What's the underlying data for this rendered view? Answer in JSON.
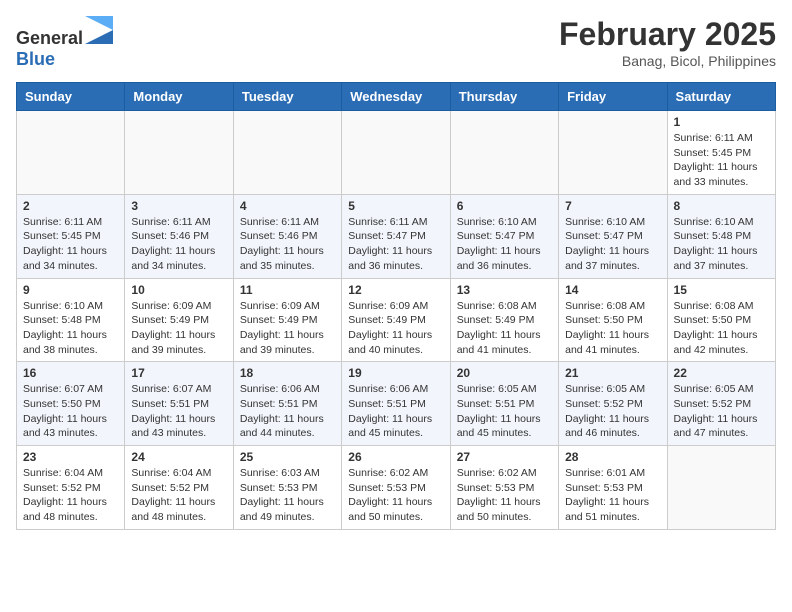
{
  "header": {
    "logo_general": "General",
    "logo_blue": "Blue",
    "month_year": "February 2025",
    "location": "Banag, Bicol, Philippines"
  },
  "weekdays": [
    "Sunday",
    "Monday",
    "Tuesday",
    "Wednesday",
    "Thursday",
    "Friday",
    "Saturday"
  ],
  "weeks": [
    [
      {
        "day": "",
        "sunrise": "",
        "sunset": "",
        "daylight": "",
        "empty": true
      },
      {
        "day": "",
        "sunrise": "",
        "sunset": "",
        "daylight": "",
        "empty": true
      },
      {
        "day": "",
        "sunrise": "",
        "sunset": "",
        "daylight": "",
        "empty": true
      },
      {
        "day": "",
        "sunrise": "",
        "sunset": "",
        "daylight": "",
        "empty": true
      },
      {
        "day": "",
        "sunrise": "",
        "sunset": "",
        "daylight": "",
        "empty": true
      },
      {
        "day": "",
        "sunrise": "",
        "sunset": "",
        "daylight": "",
        "empty": true
      },
      {
        "day": "1",
        "sunrise": "Sunrise: 6:11 AM",
        "sunset": "Sunset: 5:45 PM",
        "daylight": "Daylight: 11 hours and 33 minutes.",
        "empty": false
      }
    ],
    [
      {
        "day": "2",
        "sunrise": "Sunrise: 6:11 AM",
        "sunset": "Sunset: 5:45 PM",
        "daylight": "Daylight: 11 hours and 34 minutes.",
        "empty": false
      },
      {
        "day": "3",
        "sunrise": "Sunrise: 6:11 AM",
        "sunset": "Sunset: 5:46 PM",
        "daylight": "Daylight: 11 hours and 34 minutes.",
        "empty": false
      },
      {
        "day": "4",
        "sunrise": "Sunrise: 6:11 AM",
        "sunset": "Sunset: 5:46 PM",
        "daylight": "Daylight: 11 hours and 35 minutes.",
        "empty": false
      },
      {
        "day": "5",
        "sunrise": "Sunrise: 6:11 AM",
        "sunset": "Sunset: 5:47 PM",
        "daylight": "Daylight: 11 hours and 36 minutes.",
        "empty": false
      },
      {
        "day": "6",
        "sunrise": "Sunrise: 6:10 AM",
        "sunset": "Sunset: 5:47 PM",
        "daylight": "Daylight: 11 hours and 36 minutes.",
        "empty": false
      },
      {
        "day": "7",
        "sunrise": "Sunrise: 6:10 AM",
        "sunset": "Sunset: 5:47 PM",
        "daylight": "Daylight: 11 hours and 37 minutes.",
        "empty": false
      },
      {
        "day": "8",
        "sunrise": "Sunrise: 6:10 AM",
        "sunset": "Sunset: 5:48 PM",
        "daylight": "Daylight: 11 hours and 37 minutes.",
        "empty": false
      }
    ],
    [
      {
        "day": "9",
        "sunrise": "Sunrise: 6:10 AM",
        "sunset": "Sunset: 5:48 PM",
        "daylight": "Daylight: 11 hours and 38 minutes.",
        "empty": false
      },
      {
        "day": "10",
        "sunrise": "Sunrise: 6:09 AM",
        "sunset": "Sunset: 5:49 PM",
        "daylight": "Daylight: 11 hours and 39 minutes.",
        "empty": false
      },
      {
        "day": "11",
        "sunrise": "Sunrise: 6:09 AM",
        "sunset": "Sunset: 5:49 PM",
        "daylight": "Daylight: 11 hours and 39 minutes.",
        "empty": false
      },
      {
        "day": "12",
        "sunrise": "Sunrise: 6:09 AM",
        "sunset": "Sunset: 5:49 PM",
        "daylight": "Daylight: 11 hours and 40 minutes.",
        "empty": false
      },
      {
        "day": "13",
        "sunrise": "Sunrise: 6:08 AM",
        "sunset": "Sunset: 5:49 PM",
        "daylight": "Daylight: 11 hours and 41 minutes.",
        "empty": false
      },
      {
        "day": "14",
        "sunrise": "Sunrise: 6:08 AM",
        "sunset": "Sunset: 5:50 PM",
        "daylight": "Daylight: 11 hours and 41 minutes.",
        "empty": false
      },
      {
        "day": "15",
        "sunrise": "Sunrise: 6:08 AM",
        "sunset": "Sunset: 5:50 PM",
        "daylight": "Daylight: 11 hours and 42 minutes.",
        "empty": false
      }
    ],
    [
      {
        "day": "16",
        "sunrise": "Sunrise: 6:07 AM",
        "sunset": "Sunset: 5:50 PM",
        "daylight": "Daylight: 11 hours and 43 minutes.",
        "empty": false
      },
      {
        "day": "17",
        "sunrise": "Sunrise: 6:07 AM",
        "sunset": "Sunset: 5:51 PM",
        "daylight": "Daylight: 11 hours and 43 minutes.",
        "empty": false
      },
      {
        "day": "18",
        "sunrise": "Sunrise: 6:06 AM",
        "sunset": "Sunset: 5:51 PM",
        "daylight": "Daylight: 11 hours and 44 minutes.",
        "empty": false
      },
      {
        "day": "19",
        "sunrise": "Sunrise: 6:06 AM",
        "sunset": "Sunset: 5:51 PM",
        "daylight": "Daylight: 11 hours and 45 minutes.",
        "empty": false
      },
      {
        "day": "20",
        "sunrise": "Sunrise: 6:05 AM",
        "sunset": "Sunset: 5:51 PM",
        "daylight": "Daylight: 11 hours and 45 minutes.",
        "empty": false
      },
      {
        "day": "21",
        "sunrise": "Sunrise: 6:05 AM",
        "sunset": "Sunset: 5:52 PM",
        "daylight": "Daylight: 11 hours and 46 minutes.",
        "empty": false
      },
      {
        "day": "22",
        "sunrise": "Sunrise: 6:05 AM",
        "sunset": "Sunset: 5:52 PM",
        "daylight": "Daylight: 11 hours and 47 minutes.",
        "empty": false
      }
    ],
    [
      {
        "day": "23",
        "sunrise": "Sunrise: 6:04 AM",
        "sunset": "Sunset: 5:52 PM",
        "daylight": "Daylight: 11 hours and 48 minutes.",
        "empty": false
      },
      {
        "day": "24",
        "sunrise": "Sunrise: 6:04 AM",
        "sunset": "Sunset: 5:52 PM",
        "daylight": "Daylight: 11 hours and 48 minutes.",
        "empty": false
      },
      {
        "day": "25",
        "sunrise": "Sunrise: 6:03 AM",
        "sunset": "Sunset: 5:53 PM",
        "daylight": "Daylight: 11 hours and 49 minutes.",
        "empty": false
      },
      {
        "day": "26",
        "sunrise": "Sunrise: 6:02 AM",
        "sunset": "Sunset: 5:53 PM",
        "daylight": "Daylight: 11 hours and 50 minutes.",
        "empty": false
      },
      {
        "day": "27",
        "sunrise": "Sunrise: 6:02 AM",
        "sunset": "Sunset: 5:53 PM",
        "daylight": "Daylight: 11 hours and 50 minutes.",
        "empty": false
      },
      {
        "day": "28",
        "sunrise": "Sunrise: 6:01 AM",
        "sunset": "Sunset: 5:53 PM",
        "daylight": "Daylight: 11 hours and 51 minutes.",
        "empty": false
      },
      {
        "day": "",
        "sunrise": "",
        "sunset": "",
        "daylight": "",
        "empty": true
      }
    ]
  ]
}
